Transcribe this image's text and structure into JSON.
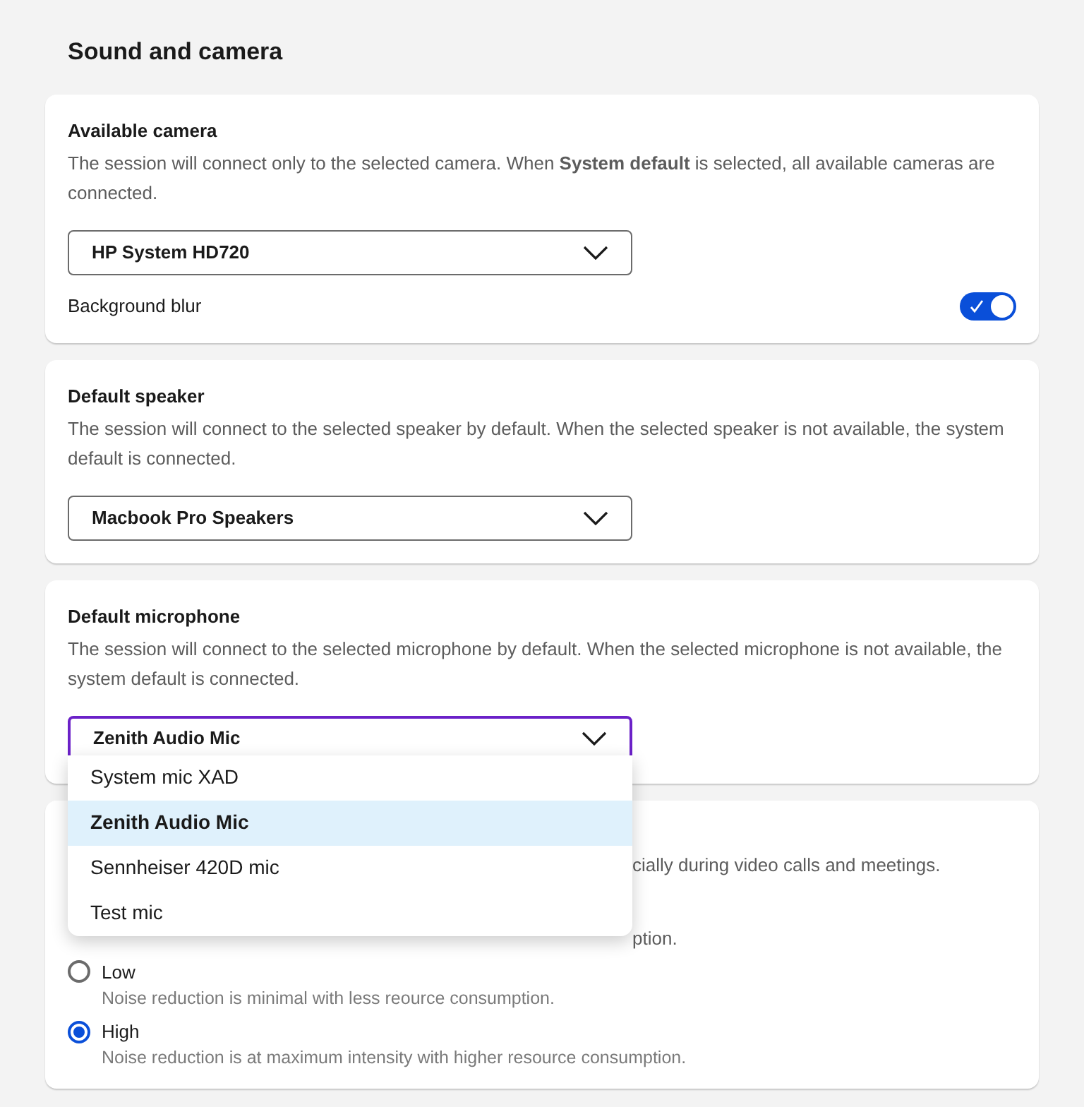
{
  "title": "Sound and camera",
  "sections": [
    {
      "heading": "Available camera",
      "description": "The session will connect only to the selected camera. When **System default** is selected, all available cameras are connected.",
      "select": {
        "value": "HP System HD720",
        "focused": false
      },
      "toggle": {
        "label": "Background blur",
        "on": true
      }
    },
    {
      "heading": "Default speaker",
      "description": "The session will connect to the selected speaker by default. When the selected speaker is not available, the system default is connected.",
      "select": {
        "value": "Macbook Pro Speakers",
        "focused": false
      }
    },
    {
      "heading": "Default microphone",
      "description": "The session will connect to the selected microphone by default. When the selected microphone is not available, the system default is connected.",
      "select": {
        "value": "Zenith Audio Mic",
        "focused": true
      },
      "menu": [
        {
          "label": "System mic XAD",
          "selected": false
        },
        {
          "label": "Zenith Audio Mic",
          "selected": true
        },
        {
          "label": "Sennheiser 420D mic",
          "selected": false
        },
        {
          "label": "Test mic",
          "selected": false
        }
      ]
    }
  ],
  "noise": {
    "description_fragment": "cially during video calls and meetings.",
    "hidden_line_fragment": "ption.",
    "options": [
      {
        "label": "Low",
        "description": "Noise reduction is minimal with less reource consumption.",
        "selected": false
      },
      {
        "label": "High",
        "description": "Noise reduction is at maximum intensity with higher resource consumption.",
        "selected": true
      }
    ]
  }
}
